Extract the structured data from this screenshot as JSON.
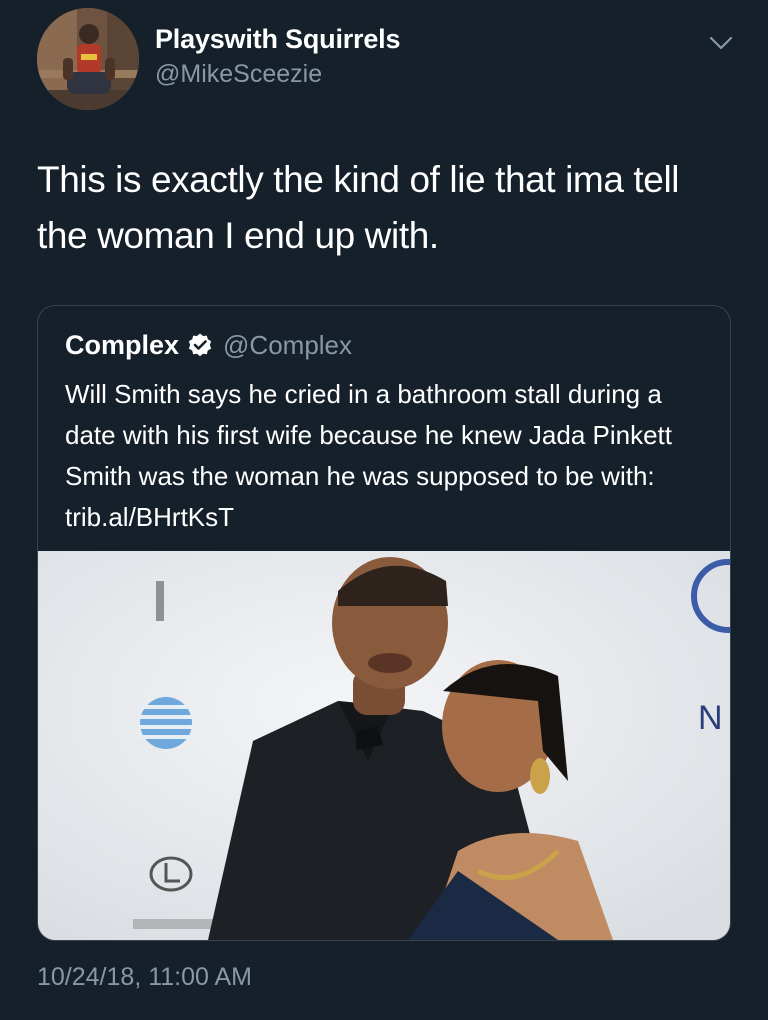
{
  "author": {
    "display_name": "Playswith Squirrels",
    "handle": "@MikeSceezie"
  },
  "tweet": {
    "text": "This is exactly the kind of lie that ima tell the woman I end up with.",
    "timestamp": "10/24/18, 11:00 AM"
  },
  "quoted_tweet": {
    "display_name": "Complex",
    "verified": true,
    "handle": "@Complex",
    "text": "Will Smith says he cried in a bathroom stall during a date with his first wife because he knew Jada Pinkett Smith was the woman he was supposed to be with: trib.al/BHrtKsT"
  },
  "icons": {
    "menu": "chevron-down-icon",
    "verified": "verified-badge-icon"
  },
  "colors": {
    "background": "#15202b",
    "secondary_text": "#8899a6",
    "border": "#38444d",
    "verified_badge": "#ffffff"
  }
}
